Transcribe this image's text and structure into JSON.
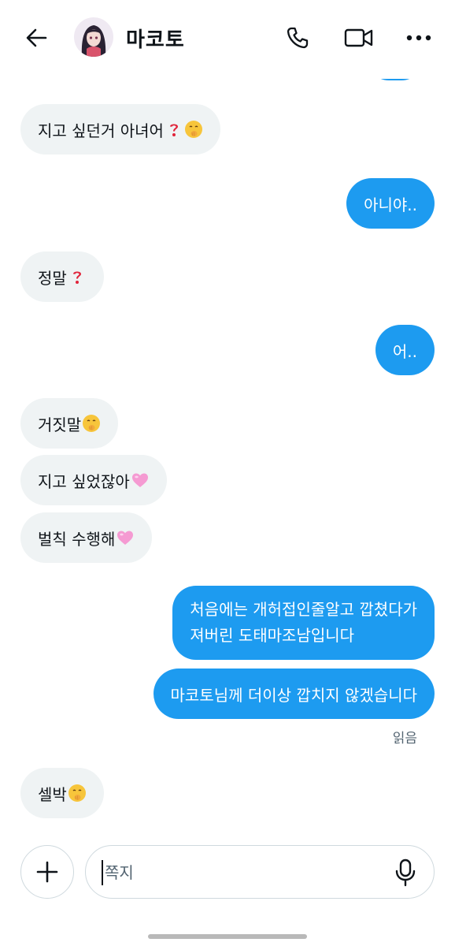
{
  "header": {
    "contact_name": "마코토",
    "icons": [
      "back-arrow-icon",
      "phone-icon",
      "video-icon",
      "more-icon"
    ]
  },
  "messages": [
    {
      "dir": "in",
      "text": "지고 싶던거 아녀어",
      "emoji": [
        "question-icon",
        "shush-face-icon"
      ]
    },
    {
      "dir": "out",
      "text": "아니야.."
    },
    {
      "dir": "in",
      "text": "정말",
      "emoji": [
        "question-icon"
      ]
    },
    {
      "dir": "out",
      "text": "어.."
    },
    {
      "dir": "in",
      "text": "거짓말",
      "emoji": [
        "shush-face-icon"
      ]
    },
    {
      "dir": "in",
      "text": "지고 싶었잖아",
      "emoji": [
        "pink-heart-icon"
      ]
    },
    {
      "dir": "in",
      "text": "벌칙 수행해",
      "emoji": [
        "pink-heart-icon"
      ]
    },
    {
      "dir": "out",
      "lines": [
        "처음에는 개허접인줄알고 깝쳤다가",
        "져버린 도태마조남입니다"
      ]
    },
    {
      "dir": "out",
      "text": "마코토님께 더이상 깝치지 않겠습니다"
    },
    {
      "dir": "in",
      "text": "셀박",
      "emoji": [
        "shush-face-icon"
      ]
    }
  ],
  "read_status": "읽음",
  "composer": {
    "placeholder": "쪽지"
  },
  "colors": {
    "outgoing": "#1d9bf0",
    "incoming": "#eff3f4",
    "muted_text": "#536471"
  }
}
